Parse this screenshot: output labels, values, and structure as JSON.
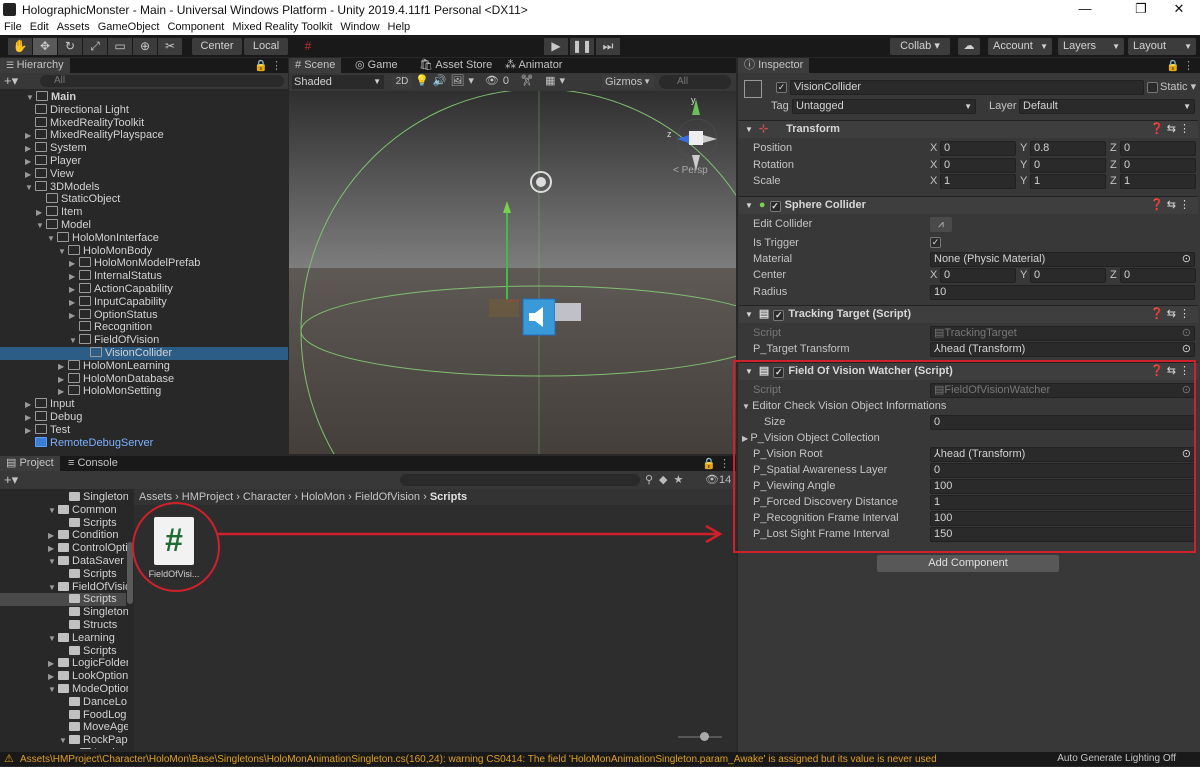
{
  "window": {
    "title": "HolographicMonster - Main - Universal Windows Platform - Unity 2019.4.11f1 Personal <DX11>",
    "min": "—",
    "max": "❐",
    "close": "✕"
  },
  "menu": [
    "File",
    "Edit",
    "Assets",
    "GameObject",
    "Component",
    "Mixed Reality Toolkit",
    "Window",
    "Help"
  ],
  "toolbar": {
    "center": "Center",
    "local": "Local",
    "collab": "Collab ▾",
    "account": "Account",
    "layers": "Layers",
    "layout": "Layout"
  },
  "hierarchy": {
    "tab": "Hierarchy",
    "search": "All",
    "items": [
      {
        "label": "Main",
        "depth": 0
      },
      {
        "label": "Directional Light",
        "depth": 1
      },
      {
        "label": "MixedRealityToolkit",
        "depth": 1
      },
      {
        "label": "MixedRealityPlayspace",
        "depth": 1
      },
      {
        "label": "System",
        "depth": 1
      },
      {
        "label": "Player",
        "depth": 1
      },
      {
        "label": "View",
        "depth": 1
      },
      {
        "label": "3DModels",
        "depth": 1
      },
      {
        "label": "StaticObject",
        "depth": 2
      },
      {
        "label": "Item",
        "depth": 2
      },
      {
        "label": "Model",
        "depth": 2
      },
      {
        "label": "HoloMonInterface",
        "depth": 3
      },
      {
        "label": "HoloMonBody",
        "depth": 4
      },
      {
        "label": "HoloMonModelPrefab",
        "depth": 5
      },
      {
        "label": "InternalStatus",
        "depth": 5
      },
      {
        "label": "ActionCapability",
        "depth": 5
      },
      {
        "label": "InputCapability",
        "depth": 5
      },
      {
        "label": "OptionStatus",
        "depth": 5
      },
      {
        "label": "Recognition",
        "depth": 5
      },
      {
        "label": "FieldOfVision",
        "depth": 5
      },
      {
        "label": "VisionCollider",
        "depth": 6
      },
      {
        "label": "HoloMonLearning",
        "depth": 4
      },
      {
        "label": "HoloMonDatabase",
        "depth": 4
      },
      {
        "label": "HoloMonSetting",
        "depth": 4
      },
      {
        "label": "Input",
        "depth": 1
      },
      {
        "label": "Debug",
        "depth": 1
      },
      {
        "label": "Test",
        "depth": 1
      },
      {
        "label": "RemoteDebugServer",
        "depth": 1
      }
    ]
  },
  "scene": {
    "tabs": [
      "Scene",
      "Game",
      "Asset Store",
      "Animator"
    ],
    "shading": "Shaded",
    "mode2d": "2D",
    "gizmos": "Gizmos",
    "search": "All",
    "persp": "< Persp",
    "hidden_count": "0"
  },
  "project": {
    "tabs": [
      "Project",
      "Console"
    ],
    "breadcrumb": [
      "Assets",
      "HMProject",
      "Character",
      "HoloMon",
      "FieldOfVision",
      "Scripts"
    ],
    "asset_label": "FieldOfVisi...",
    "count": "14",
    "folders": [
      {
        "label": "Singleton",
        "d": 2
      },
      {
        "label": "Common",
        "d": 1
      },
      {
        "label": "Scripts",
        "d": 2
      },
      {
        "label": "Condition",
        "d": 1
      },
      {
        "label": "ControlOpti",
        "d": 1
      },
      {
        "label": "DataSaver",
        "d": 1
      },
      {
        "label": "Scripts",
        "d": 2
      },
      {
        "label": "FieldOfVisio",
        "d": 1
      },
      {
        "label": "Scripts",
        "d": 2
      },
      {
        "label": "Singleton",
        "d": 2
      },
      {
        "label": "Structs",
        "d": 2
      },
      {
        "label": "Learning",
        "d": 1
      },
      {
        "label": "Scripts",
        "d": 2
      },
      {
        "label": "LogicFolder",
        "d": 1
      },
      {
        "label": "LookOption",
        "d": 1
      },
      {
        "label": "ModeOption",
        "d": 1
      },
      {
        "label": "DanceLo",
        "d": 2
      },
      {
        "label": "FoodLog",
        "d": 2
      },
      {
        "label": "MoveAge",
        "d": 2
      },
      {
        "label": "RockPap",
        "d": 2
      },
      {
        "label": "Logic",
        "d": 3
      }
    ]
  },
  "inspector": {
    "tab": "Inspector",
    "object_name": "VisionCollider",
    "static": "Static",
    "tag_label": "Tag",
    "tag": "Untagged",
    "layer_label": "Layer",
    "layer": "Default",
    "transform": {
      "title": "Transform",
      "position_label": "Position",
      "rotation_label": "Rotation",
      "scale_label": "Scale",
      "position": [
        "0",
        "0.8",
        "0"
      ],
      "rotation": [
        "0",
        "0",
        "0"
      ],
      "scale": [
        "1",
        "1",
        "1"
      ]
    },
    "sphere": {
      "title": "Sphere Collider",
      "edit": "Edit Collider",
      "trigger": "Is Trigger",
      "material_label": "Material",
      "material": "None (Physic Material)",
      "center_label": "Center",
      "center": [
        "0",
        "0",
        "0"
      ],
      "radius_label": "Radius",
      "radius": "10"
    },
    "tracking": {
      "title": "Tracking Target (Script)",
      "script_label": "Script",
      "script": "TrackingTarget",
      "p_label": "P_Target Transform",
      "p_value": "head (Transform)"
    },
    "watcher": {
      "title": "Field Of Vision Watcher (Script)",
      "script_label": "Script",
      "script": "FieldOfVisionWatcher",
      "editor_check": "Editor Check Vision Object Informations",
      "size_label": "Size",
      "size": "0",
      "collection": "P_Vision Object Collection",
      "fields": [
        {
          "label": "P_Vision Root",
          "value": "head (Transform)"
        },
        {
          "label": "P_Spatial Awareness Layer",
          "value": "0"
        },
        {
          "label": "P_Viewing Angle",
          "value": "100"
        },
        {
          "label": "P_Forced Discovery Distance",
          "value": "1"
        },
        {
          "label": "P_Recognition Frame Interval",
          "value": "100"
        },
        {
          "label": "P_Lost Sight Frame Interval",
          "value": "150"
        }
      ]
    },
    "add_component": "Add Component"
  },
  "status": {
    "warning": "Assets\\HMProject\\Character\\HoloMon\\Base\\Singletons\\HoloMonAnimationSingleton.cs(160,24): warning CS0414: The field 'HoloMonAnimationSingleton.param_Awake' is assigned but its value is never used",
    "lighting": "Auto Generate Lighting Off"
  },
  "colors": {
    "highlight": "#d0202a",
    "selection": "#2c5d87",
    "accent": "#4c7cf3"
  }
}
